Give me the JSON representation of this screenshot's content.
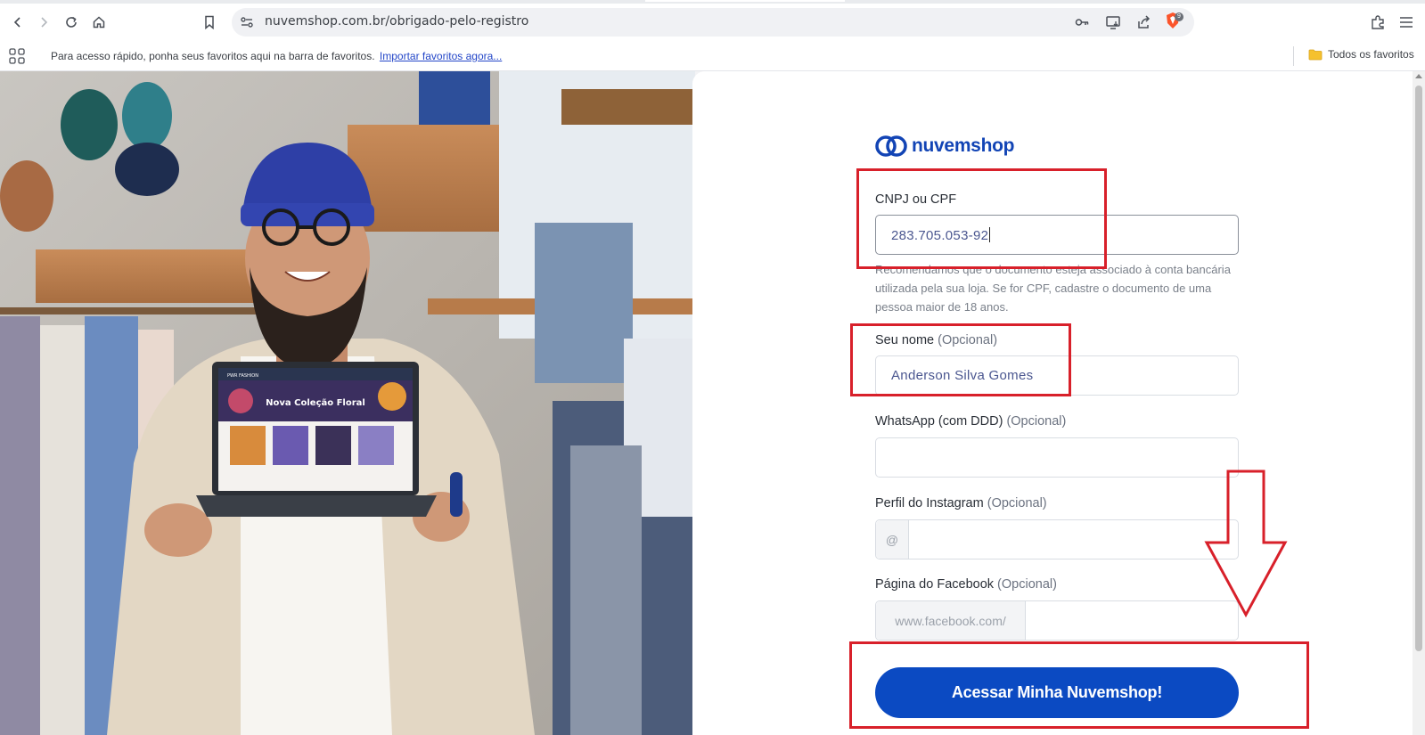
{
  "browser": {
    "url": "nuvemshop.com.br/obrigado-pelo-registro",
    "extension_badge": "9",
    "bookmarks_bar": {
      "message": "Para acesso rápido, ponha seus favoritos aqui na barra de favoritos.",
      "import_link": "Importar favoritos agora...",
      "all_bookmarks": "Todos os favoritos"
    }
  },
  "laptop_screen": {
    "store_name": "PWR FASHION",
    "banner_title": "Nova Coleção Floral"
  },
  "form": {
    "brand": "nuvemshop",
    "cnpj": {
      "label": "CNPJ ou CPF",
      "value": "283.705.053-92",
      "help": "Recomendamos que o documento esteja associado à conta bancária utilizada pela sua loja. Se for CPF, cadastre o documento de uma pessoa maior de 18 anos."
    },
    "name": {
      "label": "Seu nome",
      "optional": "(Opcional)",
      "value": "Anderson Silva Gomes"
    },
    "whatsapp": {
      "label": "WhatsApp (com DDD)",
      "optional": "(Opcional)",
      "value": ""
    },
    "instagram": {
      "label": "Perfil do Instagram",
      "optional": "(Opcional)",
      "prefix": "@",
      "value": ""
    },
    "facebook": {
      "label": "Página do Facebook",
      "optional": "(Opcional)",
      "prefix": "www.facebook.com/",
      "value": ""
    },
    "submit_label": "Acessar Minha Nuvemshop!"
  },
  "colors": {
    "brand_blue": "#1244b5",
    "button_blue": "#0b4ac2",
    "annotation_red": "#d8202a"
  }
}
